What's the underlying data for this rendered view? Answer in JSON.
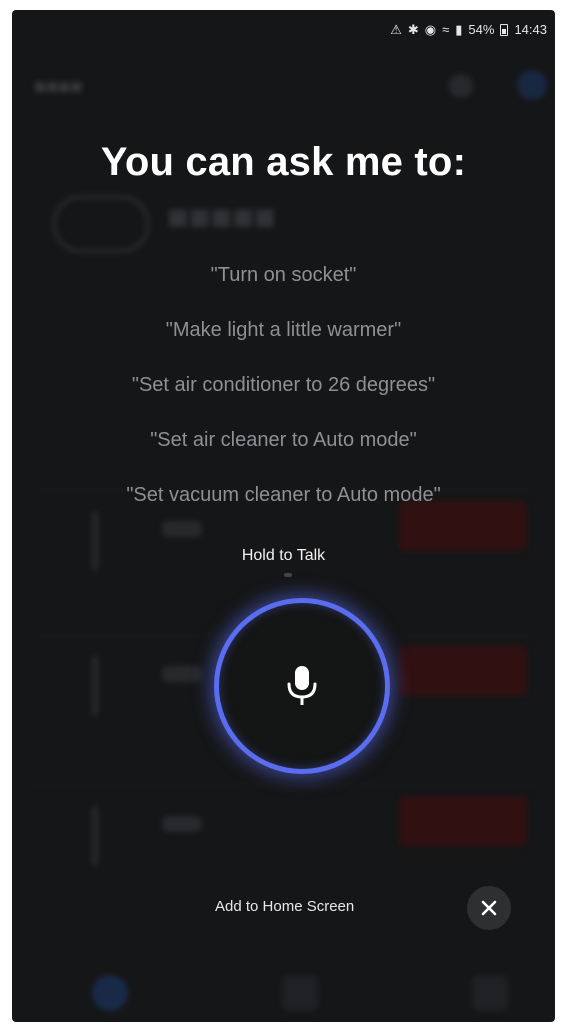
{
  "status_bar": {
    "battery_percent": "54%",
    "time": "14:43"
  },
  "overlay": {
    "title": "You can ask me to:",
    "examples": [
      "\"Turn on socket\"",
      "\"Make light a little warmer\"",
      "\"Set air conditioner to 26 degrees\"",
      "\"Set air cleaner to Auto mode\"",
      "\"Set vacuum cleaner to Auto mode\""
    ],
    "hold_to_talk": "Hold to Talk",
    "add_to_home": "Add to Home Screen"
  },
  "colors": {
    "accent_ring": "#5a6cf0",
    "background": "#151617",
    "example_text": "#8f9094"
  },
  "icons": {
    "mic": "microphone-icon",
    "close": "close-icon"
  }
}
